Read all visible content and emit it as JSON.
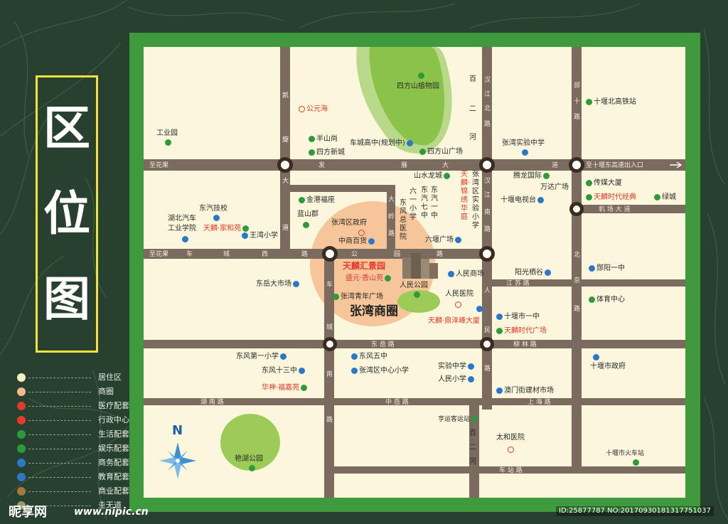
{
  "title_chars": [
    "区",
    "位",
    "图"
  ],
  "legend": [
    {
      "label": "居住区",
      "color": "#f4f0c8"
    },
    {
      "label": "商圈",
      "color": "#f7b98a"
    },
    {
      "label": "医疗配套",
      "color": "#e33b2b"
    },
    {
      "label": "行政中心",
      "color": "#e33b2b"
    },
    {
      "label": "生活配套",
      "color": "#2f9a3a"
    },
    {
      "label": "娱乐配套",
      "color": "#2f9a3a"
    },
    {
      "label": "商务配套",
      "color": "#2a79c8"
    },
    {
      "label": "教育配套",
      "color": "#2a79c8"
    },
    {
      "label": "商业配套",
      "color": "#a37a3a"
    },
    {
      "label": "圭无道",
      "color": "#9a9a6a"
    }
  ],
  "colors": {
    "frame": "#3e9a3c",
    "map_bg": "#fbf6dc",
    "road": "#7b6a5e",
    "park": "#9dcb58",
    "business_circle": "#f6c295",
    "accent_red": "#e33b2b"
  },
  "compass_letter": "N",
  "roads": {
    "developed_ave": [
      "至花果",
      "发",
      "展",
      "大",
      "道",
      "至十堰东高速出入口"
    ],
    "city_west": [
      "至花果",
      "车",
      "城",
      "西",
      "路",
      "公",
      "园",
      "路"
    ],
    "kaixuan": [
      "凯",
      "旋",
      "大",
      "道"
    ],
    "hanjiang_north": [
      "汉",
      "江",
      "北",
      "路"
    ],
    "hanjiang_south": [
      "汉",
      "江",
      "南",
      "路"
    ],
    "yunshi": [
      "郧",
      "十",
      "路"
    ],
    "beijing": [
      "北",
      "京",
      "路"
    ],
    "damling": [
      "大",
      "岭",
      "路"
    ],
    "chenan_south": [
      "车",
      "城",
      "南",
      "路"
    ],
    "renmin": [
      "人",
      "民",
      "路"
    ],
    "jiangsu": "江 苏 路",
    "dongyue": "东 岳 路",
    "liulin": "柳 林 路",
    "hunan": "湖 南 路",
    "zhongyuan": "中 岳 路",
    "shanghai": "上 海 路",
    "chezhan": "车 站 路",
    "airport": "机 场 大 道",
    "baier": [
      "百",
      "二",
      "河"
    ]
  },
  "pois": {
    "industrial_park": "工业园",
    "gongyuanhai": "公元海",
    "banshanshang": "半山尚",
    "sifangxincheng": "四方新城",
    "chechenggaozhong": "车城高中(规划中)",
    "sifangshan_garden": "四方山植物园",
    "sifangshan_square": "四方山广场",
    "zhangwan_exp_middle": "张湾实验中学",
    "yunshi_north_station": "十堰北高铁站",
    "tenglong": "腾龙国际",
    "wanda": "万达广场",
    "chuanmei": "传媒大厦",
    "tianlin_era": "天麟时代经典",
    "lvcheng": "绿城",
    "tv_tower": "十堰电视台",
    "shanshuilongcheng": "山水龙城",
    "zhangwan_exp_primary": "张湾区实验小学",
    "jinxiu_huating": "天麟·锦绣华庭",
    "dongqi_yizhong": "东汽一中",
    "dongqi_qizhong": "东汽七中",
    "liuyi_primary": "六一小学",
    "dongfeng_hospital": "东风总医院",
    "liuyan_square": "六堰广场",
    "jingangfuzuo": "金港福座",
    "lanshanjun": "蓝山郡",
    "zhangwan_gov": "张湾区政府",
    "zhongshang": "中商百货",
    "dongfeng_tech": "东汽技校",
    "hubei_auto": "湖北汽车",
    "hubei_auto2": "工业学院",
    "jiahe": "天麟·家和苑",
    "wangwan_primary": "王湾小学",
    "tianlin_huijing": "天麟汇景园",
    "shengyuan": "盛元·香山苑",
    "renmin_park": "人民公园",
    "renmin_mall": "人民商场",
    "zhangwan_youth": "张湾青年广场",
    "renmin_hospital": "人民医院",
    "zhangwan_circle": "张湾商圈",
    "yanze_tower": "天麟·鼎泽峰大厦",
    "yangguang": "阳光栖谷",
    "yunyang_yizhong": "郧阳一中",
    "sports_center": "体育中心",
    "shiyan_yizhong": "十堰市一中",
    "tianlin_plaza": "天麟时代广场",
    "dongyue_market": "东岳大市场",
    "dongfeng_no1": "东风第一小学",
    "dongfeng_no13": "东风十三中",
    "huashen": "华神·福嘉苑",
    "dongfeng_no5": "东风五中",
    "zhangwan_center_primary": "张湾区中心小学",
    "shiyan_middle": "实验中学",
    "renmin_primary": "人民小学",
    "aomen_market": "澳门街建材市场",
    "shiyan_gov": "十堰市政府",
    "bus_station": "亨运客运站",
    "taihe_hospital": "太和医院",
    "yanhu_park": "艳湖公园",
    "shiyan_train": "十堰市火车站"
  },
  "watermark": {
    "brand": "昵享网",
    "url": "www.nipic.cn",
    "image_id": "ID:25877787 NO:20170930181317751037"
  }
}
